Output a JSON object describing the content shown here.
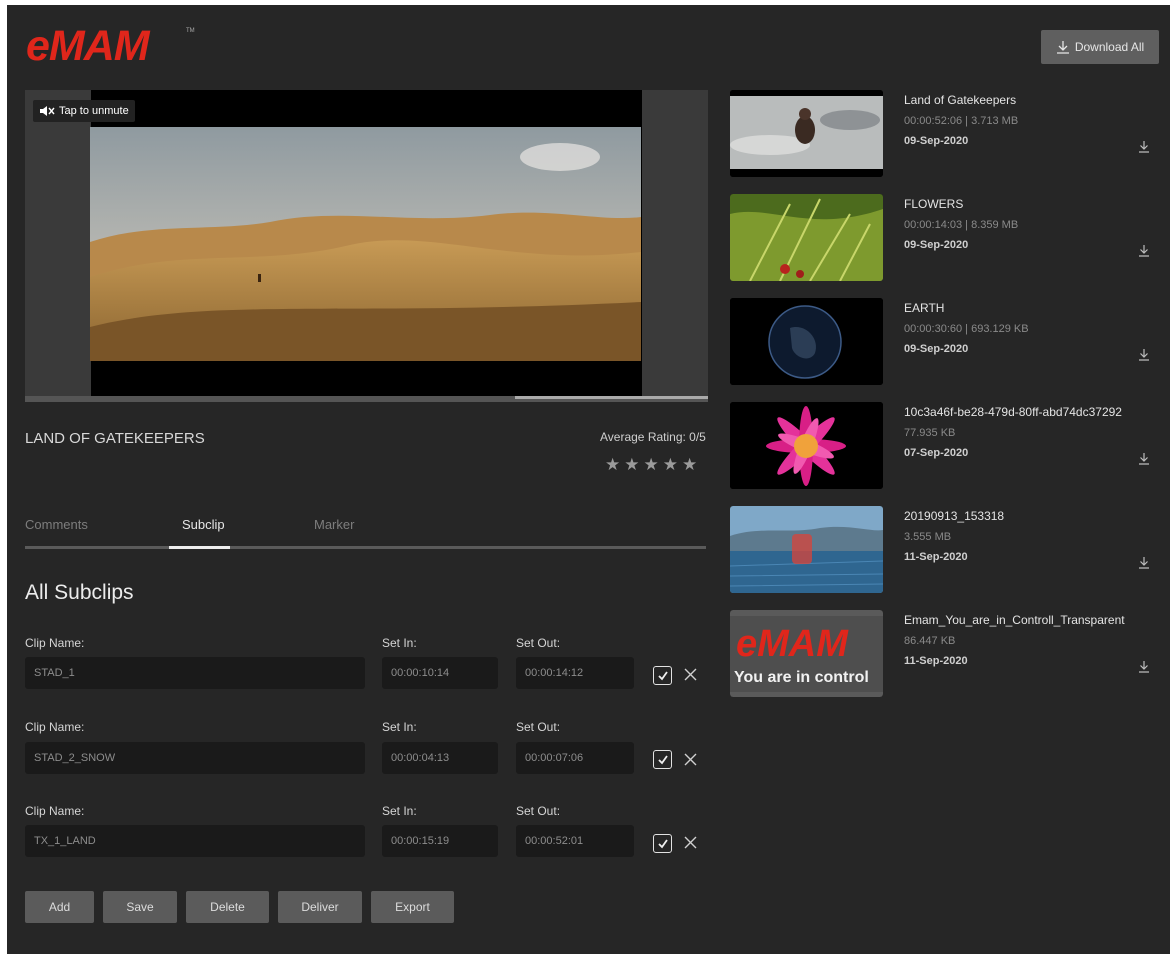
{
  "header": {
    "logo_text": "eMAM",
    "download_all_label": "Download All"
  },
  "player": {
    "mute_label": "Tap to unmute",
    "progress_fraction": 0.0
  },
  "video": {
    "title": "LAND OF GATEKEEPERS",
    "rating_label": "Average Rating: 0/5",
    "stars": [
      "★",
      "★",
      "★",
      "★",
      "★"
    ],
    "rating_value": 0
  },
  "tabs": [
    {
      "label": "Comments"
    },
    {
      "label": "Subclip",
      "active": true
    },
    {
      "label": "Marker"
    }
  ],
  "subclips": {
    "title": "All Subclips",
    "clip_name_label": "Clip Name:",
    "set_in_label": "Set In:",
    "set_out_label": "Set Out:",
    "rows": [
      {
        "name": "STAD_1",
        "set_in": "00:00:10:14",
        "set_out": "00:00:14:12"
      },
      {
        "name": "STAD_2_SNOW",
        "set_in": "00:00:04:13",
        "set_out": "00:00:07:06"
      },
      {
        "name": "TX_1_LAND",
        "set_in": "00:00:15:19",
        "set_out": "00:00:52:01"
      }
    ]
  },
  "actions": [
    "Add",
    "Save",
    "Delete",
    "Deliver",
    "Export"
  ],
  "media": [
    {
      "title": "Land of Gatekeepers",
      "meta": "00:00:52:06  |  3.713 MB",
      "date": "09-Sep-2020",
      "thumb": "desert-figure"
    },
    {
      "title": "FLOWERS",
      "meta": "00:00:14:03  |  8.359 MB",
      "date": "09-Sep-2020",
      "thumb": "grass"
    },
    {
      "title": "EARTH",
      "meta": "00:00:30:60  |  693.129 KB",
      "date": "09-Sep-2020",
      "thumb": "globe"
    },
    {
      "title": "10c3a46f-be28-479d-80ff-abd74dc37292",
      "meta": "77.935 KB",
      "date": "07-Sep-2020",
      "thumb": "flower"
    },
    {
      "title": "20190913_153318",
      "meta": "3.555 MB",
      "date": "11-Sep-2020",
      "thumb": "lake"
    },
    {
      "title": "Emam_You_are_in_Controll_Transparent",
      "meta": "86.447 KB",
      "date": "11-Sep-2020",
      "thumb": "emam-logo",
      "thumb_text_1": "eMAM",
      "thumb_text_2": "You are in control"
    }
  ],
  "colors": {
    "background": "#262626",
    "accent_red": "#e0261b",
    "button": "#5b5b5b"
  }
}
